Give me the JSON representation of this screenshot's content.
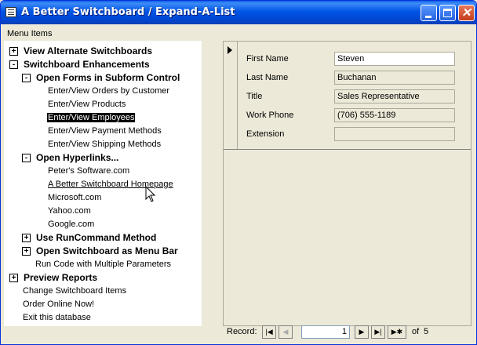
{
  "window": {
    "title": "A Better Switchboard / Expand-A-List"
  },
  "menu_label": "Menu Items",
  "tree": {
    "items": [
      {
        "label": "View Alternate Switchboards",
        "toggle": "+"
      },
      {
        "label": "Switchboard Enhancements",
        "toggle": "-"
      },
      {
        "label": "Open Forms in Subform Control",
        "toggle": "-"
      },
      {
        "label": "Enter/View Orders by Customer"
      },
      {
        "label": "Enter/View Products"
      },
      {
        "label": "Enter/View Employees"
      },
      {
        "label": "Enter/View Payment Methods"
      },
      {
        "label": "Enter/View Shipping Methods"
      },
      {
        "label": "Open Hyperlinks...",
        "toggle": "-"
      },
      {
        "label": "Peter's Software.com"
      },
      {
        "label": "A Better Switchboard Homepage"
      },
      {
        "label": "Microsoft.com"
      },
      {
        "label": "Yahoo.com"
      },
      {
        "label": "Google.com"
      },
      {
        "label": "Use RunCommand Method",
        "toggle": "+"
      },
      {
        "label": "Open Switchboard as Menu Bar",
        "toggle": "+"
      },
      {
        "label": "Run Code with Multiple Parameters"
      },
      {
        "label": "Preview Reports",
        "toggle": "+"
      },
      {
        "label": "Change Switchboard Items"
      },
      {
        "label": "Order Online Now!"
      },
      {
        "label": "Exit this database"
      }
    ]
  },
  "form": {
    "fields": [
      {
        "label": "First Name",
        "value": "Steven"
      },
      {
        "label": "Last Name",
        "value": "Buchanan"
      },
      {
        "label": "Title",
        "value": "Sales Representative"
      },
      {
        "label": "Work Phone",
        "value": "(706) 555-1189"
      },
      {
        "label": "Extension",
        "value": ""
      }
    ]
  },
  "navigator": {
    "label": "Record:",
    "current": "1",
    "of_label": "of",
    "total": "5"
  }
}
